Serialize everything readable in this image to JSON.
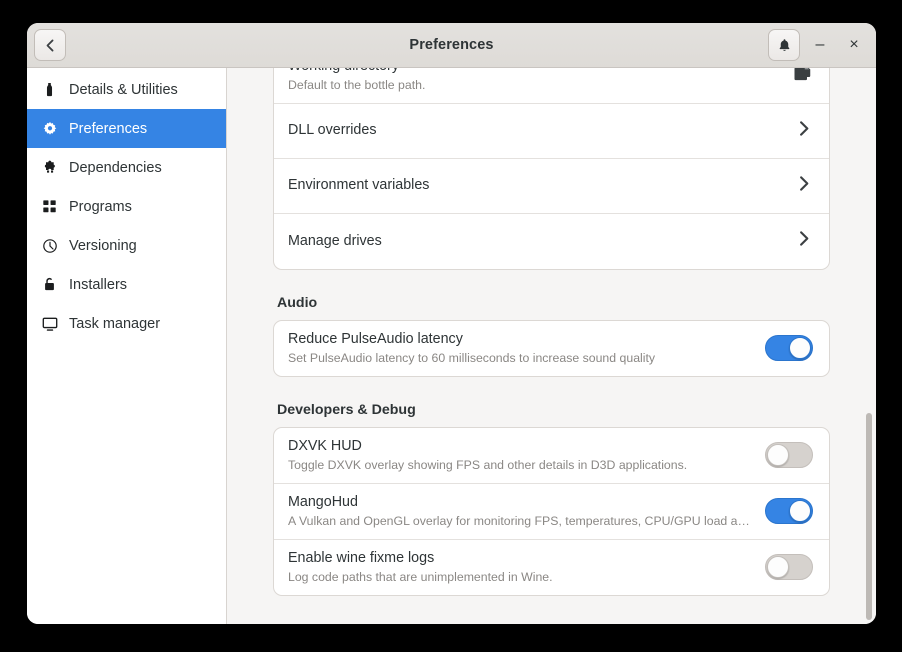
{
  "window": {
    "title": "Preferences",
    "back_button_icon": "chevron-left-icon",
    "notifications_icon": "bell-icon",
    "minimize_label": "–",
    "close_label": "×"
  },
  "sidebar": {
    "items": [
      {
        "label": "Details & Utilities",
        "icon": "bottle-icon",
        "active": false
      },
      {
        "label": "Preferences",
        "icon": "gear-icon",
        "active": true
      },
      {
        "label": "Dependencies",
        "icon": "puzzle-piece-icon",
        "active": false
      },
      {
        "label": "Programs",
        "icon": "grid-icon",
        "active": false
      },
      {
        "label": "Versioning",
        "icon": "clock-icon",
        "active": false
      },
      {
        "label": "Installers",
        "icon": "lock-icon",
        "active": false
      },
      {
        "label": "Task manager",
        "icon": "monitor-icon",
        "active": false
      }
    ]
  },
  "main": {
    "top_group": {
      "rows": [
        {
          "title": "Working directory",
          "subtitle": "Default to the bottle path.",
          "action": "document-open-icon"
        },
        {
          "title": "DLL overrides",
          "subtitle": "",
          "action": "chevron-right-icon"
        },
        {
          "title": "Environment variables",
          "subtitle": "",
          "action": "chevron-right-icon"
        },
        {
          "title": "Manage drives",
          "subtitle": "",
          "action": "chevron-right-icon"
        }
      ]
    },
    "audio_section": {
      "heading": "Audio",
      "rows": [
        {
          "title": "Reduce PulseAudio latency",
          "subtitle": "Set PulseAudio latency to 60 milliseconds to increase sound quality",
          "action": "toggle",
          "state": "on"
        }
      ]
    },
    "debug_section": {
      "heading": "Developers & Debug",
      "rows": [
        {
          "title": "DXVK HUD",
          "subtitle": "Toggle DXVK overlay showing FPS and other details in D3D applications.",
          "action": "toggle",
          "state": "off"
        },
        {
          "title": "MangoHud",
          "subtitle": "A Vulkan and OpenGL overlay for monitoring FPS, temperatures, CPU/GPU load and …",
          "action": "toggle",
          "state": "on"
        },
        {
          "title": "Enable wine fixme logs",
          "subtitle": "Log code paths that are unimplemented in Wine.",
          "action": "toggle",
          "state": "off"
        }
      ]
    }
  },
  "colors": {
    "accent": "#3584e4",
    "headerbar": "#dedbd7",
    "content_bg": "#f6f5f4",
    "card_bg": "#ffffff",
    "text": "#2e3436",
    "subtext": "#8a8784"
  }
}
